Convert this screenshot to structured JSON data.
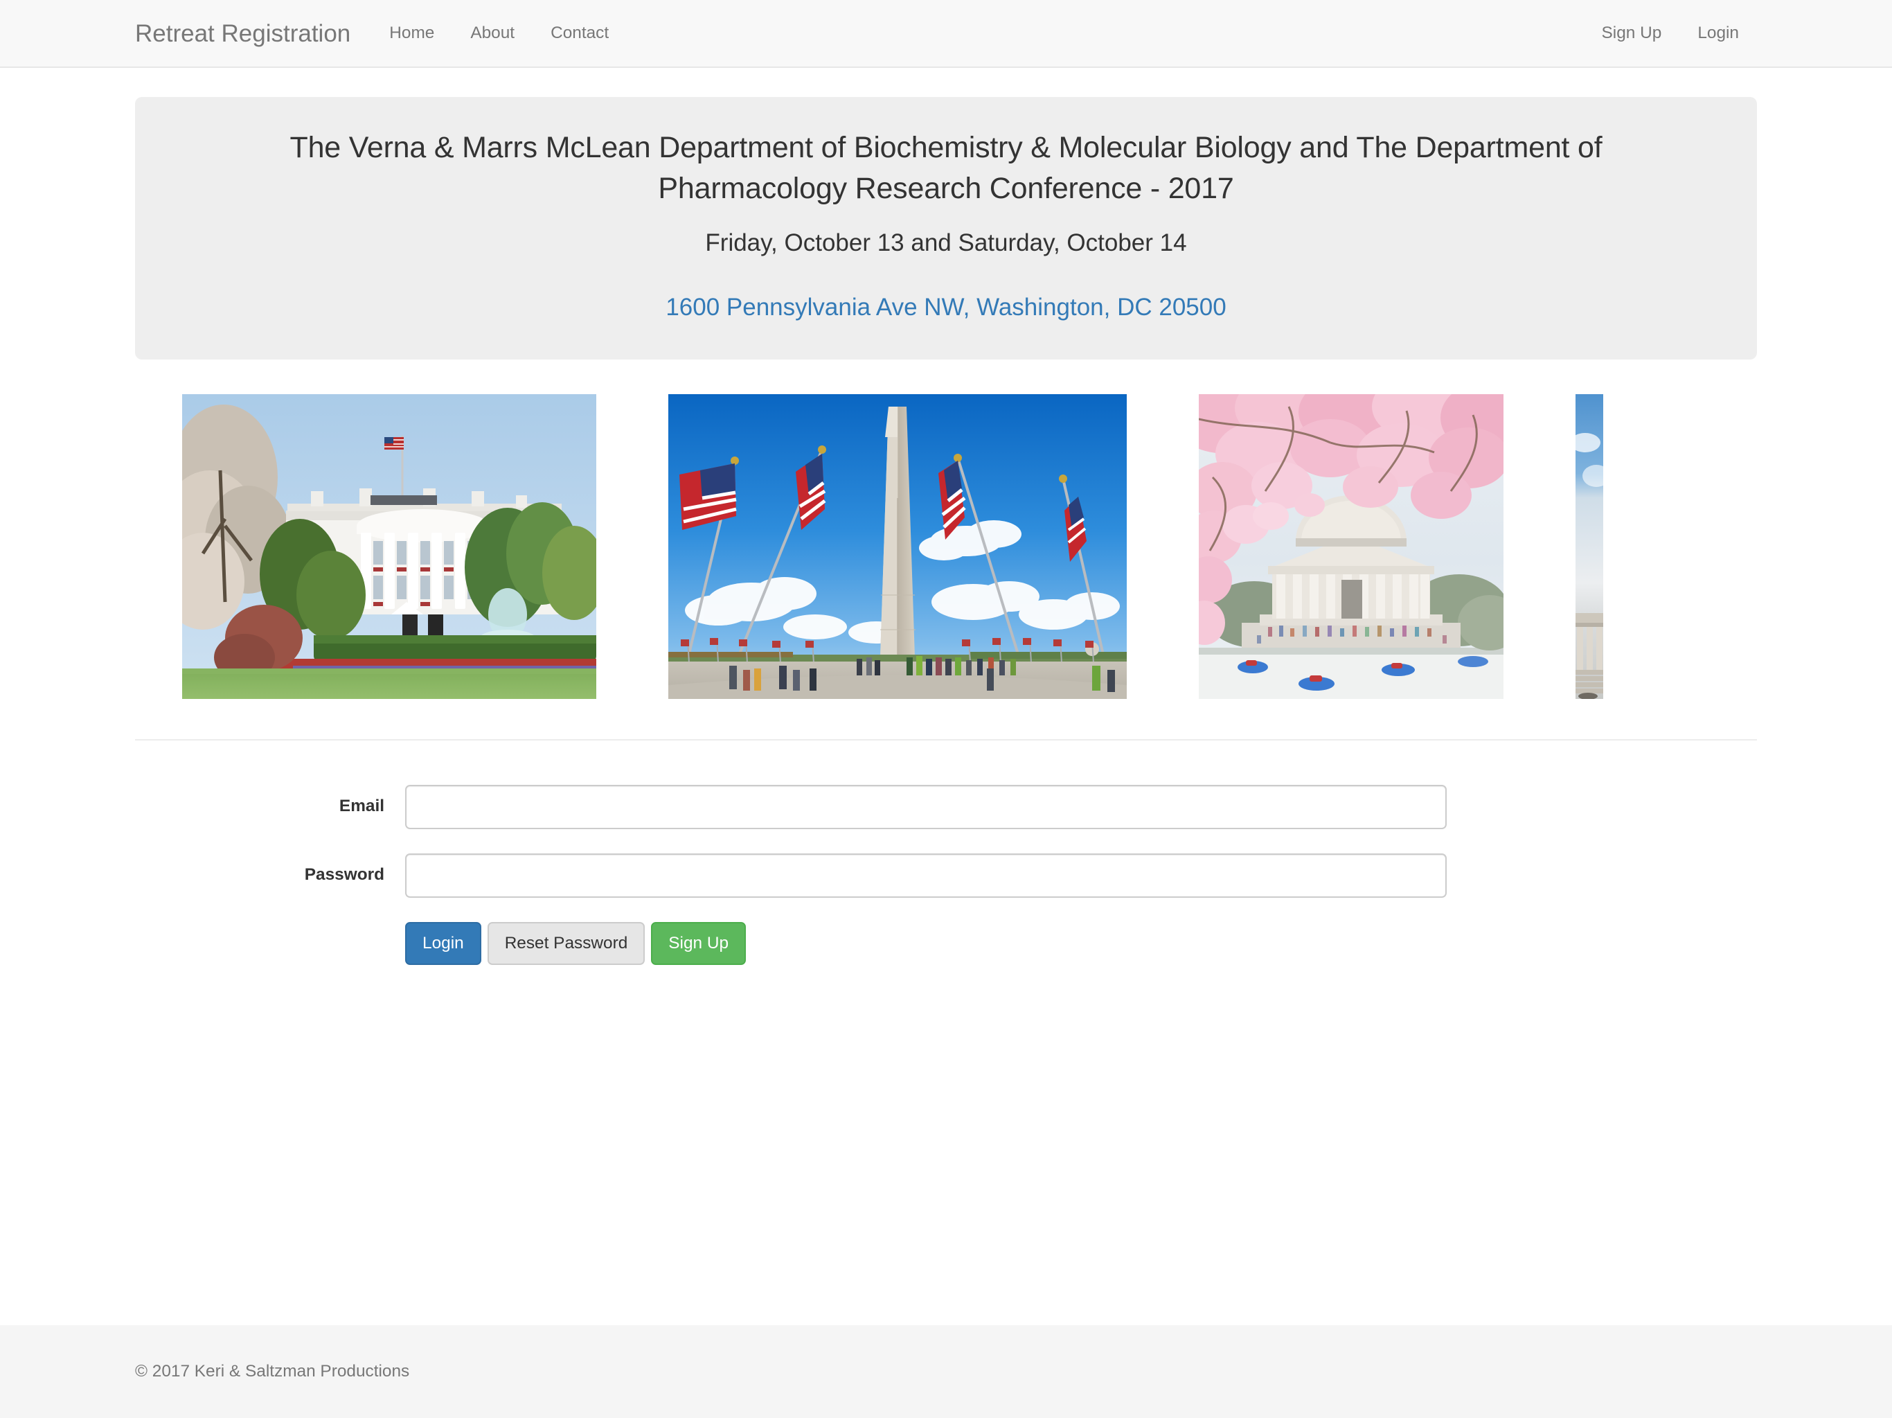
{
  "navbar": {
    "brand": "Retreat Registration",
    "left_links": [
      {
        "label": "Home",
        "name": "nav-link-home"
      },
      {
        "label": "About",
        "name": "nav-link-about"
      },
      {
        "label": "Contact",
        "name": "nav-link-contact"
      }
    ],
    "right_links": [
      {
        "label": "Sign Up",
        "name": "nav-link-signup"
      },
      {
        "label": "Login",
        "name": "nav-link-login"
      }
    ]
  },
  "jumbotron": {
    "title": "The Verna & Marrs McLean Department of Biochemistry & Molecular Biology and The Department of Pharmacology Research Conference - 2017",
    "dates": "Friday, October 13 and Saturday, October 14",
    "address": "1600 Pennsylvania Ave NW, Washington, DC 20500",
    "address_link_color": "#337ab7",
    "background_color": "#eeeeee"
  },
  "carousel": {
    "slides": [
      {
        "name": "carousel-slide-partial-left",
        "alt": "washington-monument-flags-partial"
      },
      {
        "name": "carousel-slide-white-house",
        "alt": "white-house-south-lawn"
      },
      {
        "name": "carousel-slide-washington-monument",
        "alt": "washington-monument-with-flags"
      },
      {
        "name": "carousel-slide-jefferson-memorial",
        "alt": "jefferson-memorial-cherry-blossoms"
      },
      {
        "name": "carousel-slide-partial-right",
        "alt": "lincoln-memorial-partial"
      }
    ]
  },
  "form": {
    "email": {
      "label": "Email",
      "value": "",
      "placeholder": ""
    },
    "password": {
      "label": "Password",
      "value": "",
      "placeholder": ""
    },
    "buttons": [
      {
        "label": "Login",
        "name": "login-button",
        "style": "primary",
        "color": "#337ab7"
      },
      {
        "label": "Reset Password",
        "name": "reset-password-button",
        "style": "default",
        "color": "#e6e6e6"
      },
      {
        "label": "Sign Up",
        "name": "signup-button",
        "style": "success",
        "color": "#5cb85c"
      }
    ]
  },
  "footer": {
    "copyright": "© 2017 Keri & Saltzman Productions"
  }
}
